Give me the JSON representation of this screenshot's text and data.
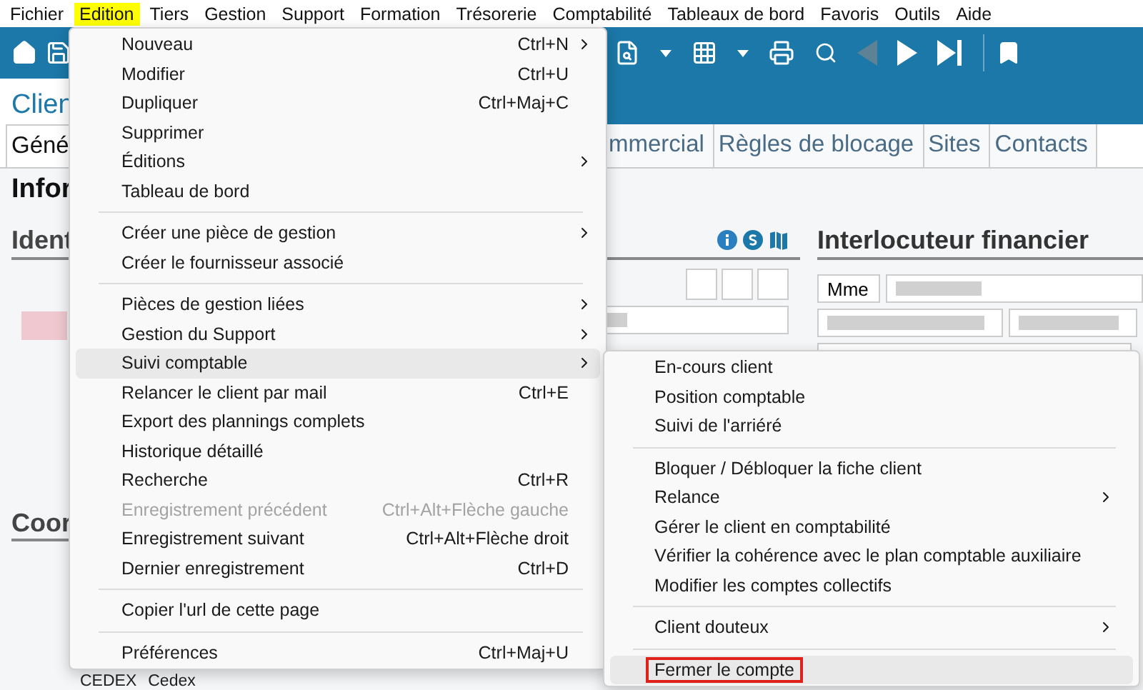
{
  "menubar": [
    {
      "label": "Fichier",
      "selected": false
    },
    {
      "label": "Edition",
      "selected": true
    },
    {
      "label": "Tiers",
      "selected": false
    },
    {
      "label": "Gestion",
      "selected": false
    },
    {
      "label": "Support",
      "selected": false
    },
    {
      "label": "Formation",
      "selected": false
    },
    {
      "label": "Trésorerie",
      "selected": false
    },
    {
      "label": "Comptabilité",
      "selected": false
    },
    {
      "label": "Tableaux de bord",
      "selected": false
    },
    {
      "label": "Favoris",
      "selected": false
    },
    {
      "label": "Outils",
      "selected": false
    },
    {
      "label": "Aide",
      "selected": false
    }
  ],
  "toolbar": {
    "left": [
      {
        "kind": "home",
        "disabled": false
      },
      {
        "kind": "save",
        "disabled": false
      }
    ],
    "right": [
      {
        "kind": "find-doc",
        "disabled": false
      },
      {
        "kind": "caret",
        "disabled": false
      },
      {
        "kind": "grid",
        "disabled": false
      },
      {
        "kind": "caret",
        "disabled": false
      },
      {
        "kind": "print",
        "disabled": false
      },
      {
        "kind": "search",
        "disabled": false
      },
      {
        "kind": "prev",
        "disabled": true
      },
      {
        "kind": "next",
        "disabled": false
      },
      {
        "kind": "last",
        "disabled": false
      },
      {
        "kind": "separator"
      },
      {
        "kind": "bookmark",
        "disabled": false
      }
    ]
  },
  "page": {
    "title": "Clien",
    "tabs": [
      {
        "label": "Géné",
        "selected": true
      },
      {
        "label": "mmercial",
        "selected": false
      },
      {
        "label": "Règles de blocage",
        "selected": false
      },
      {
        "label": "Sites",
        "selected": false
      },
      {
        "label": "Contacts",
        "selected": false
      }
    ],
    "section": "Infor",
    "identity": {
      "heading": "Ident"
    },
    "coordinates": {
      "heading": "Coor",
      "postal_code": "CEDEX",
      "city": "Cedex"
    },
    "financial": {
      "heading": "Interlocuteur financier",
      "civility": "Mme"
    }
  },
  "menu": {
    "items": [
      {
        "kind": "item",
        "label": "Nouveau",
        "shortcut": "Ctrl+N",
        "submenu": true,
        "disabled": false,
        "selected": false
      },
      {
        "kind": "item",
        "label": "Modifier",
        "shortcut": "Ctrl+U",
        "submenu": false,
        "disabled": false,
        "selected": false
      },
      {
        "kind": "item",
        "label": "Dupliquer",
        "shortcut": "Ctrl+Maj+C",
        "submenu": false,
        "disabled": false,
        "selected": false
      },
      {
        "kind": "item",
        "label": "Supprimer",
        "submenu": false,
        "disabled": false,
        "selected": false
      },
      {
        "kind": "item",
        "label": "Éditions",
        "submenu": true,
        "disabled": false,
        "selected": false
      },
      {
        "kind": "item",
        "label": "Tableau de bord",
        "submenu": false,
        "disabled": false,
        "selected": false
      },
      {
        "kind": "separator"
      },
      {
        "kind": "item",
        "label": "Créer une pièce de gestion",
        "submenu": true,
        "disabled": false,
        "selected": false
      },
      {
        "kind": "item",
        "label": "Créer le fournisseur associé",
        "submenu": false,
        "disabled": false,
        "selected": false
      },
      {
        "kind": "separator"
      },
      {
        "kind": "item",
        "label": "Pièces de gestion liées",
        "submenu": true,
        "disabled": false,
        "selected": false
      },
      {
        "kind": "item",
        "label": "Gestion du Support",
        "submenu": true,
        "disabled": false,
        "selected": false
      },
      {
        "kind": "item",
        "label": "Suivi comptable",
        "submenu": true,
        "disabled": false,
        "selected": true
      },
      {
        "kind": "item",
        "label": "Relancer le client par mail",
        "shortcut": "Ctrl+E",
        "submenu": false,
        "disabled": false,
        "selected": false
      },
      {
        "kind": "item",
        "label": "Export des plannings complets",
        "submenu": false,
        "disabled": false,
        "selected": false
      },
      {
        "kind": "item",
        "label": "Historique détaillé",
        "submenu": false,
        "disabled": false,
        "selected": false
      },
      {
        "kind": "item",
        "label": "Recherche",
        "shortcut": "Ctrl+R",
        "submenu": false,
        "disabled": false,
        "selected": false
      },
      {
        "kind": "item",
        "label": "Enregistrement précédent",
        "shortcut": "Ctrl+Alt+Flèche gauche",
        "submenu": false,
        "disabled": true,
        "selected": false
      },
      {
        "kind": "item",
        "label": "Enregistrement suivant",
        "shortcut": "Ctrl+Alt+Flèche droit",
        "submenu": false,
        "disabled": false,
        "selected": false
      },
      {
        "kind": "item",
        "label": "Dernier enregistrement",
        "shortcut": "Ctrl+D",
        "submenu": false,
        "disabled": false,
        "selected": false
      },
      {
        "kind": "separator"
      },
      {
        "kind": "item",
        "label": "Copier l'url de cette page",
        "submenu": false,
        "disabled": false,
        "selected": false
      },
      {
        "kind": "separator"
      },
      {
        "kind": "item",
        "label": "Préférences",
        "shortcut": "Ctrl+Maj+U",
        "submenu": false,
        "disabled": false,
        "selected": false
      }
    ]
  },
  "submenu": {
    "items": [
      {
        "kind": "item",
        "label": "En-cours client",
        "submenu": false,
        "selected": false,
        "outlined": false
      },
      {
        "kind": "item",
        "label": "Position comptable",
        "submenu": false,
        "selected": false,
        "outlined": false
      },
      {
        "kind": "item",
        "label": "Suivi de l'arriéré",
        "submenu": false,
        "selected": false,
        "outlined": false
      },
      {
        "kind": "separator"
      },
      {
        "kind": "item",
        "label": "Bloquer / Débloquer la fiche client",
        "submenu": false,
        "selected": false,
        "outlined": false
      },
      {
        "kind": "item",
        "label": "Relance",
        "submenu": true,
        "selected": false,
        "outlined": false
      },
      {
        "kind": "item",
        "label": "Gérer le client en comptabilité",
        "submenu": false,
        "selected": false,
        "outlined": false
      },
      {
        "kind": "item",
        "label": "Vérifier la cohérence avec le plan comptable auxiliaire",
        "submenu": false,
        "selected": false,
        "outlined": false
      },
      {
        "kind": "item",
        "label": "Modifier les comptes collectifs",
        "submenu": false,
        "selected": false,
        "outlined": false
      },
      {
        "kind": "separator"
      },
      {
        "kind": "item",
        "label": "Client douteux",
        "submenu": true,
        "selected": false,
        "outlined": false
      },
      {
        "kind": "separator"
      },
      {
        "kind": "item",
        "label": "Fermer le compte",
        "submenu": false,
        "selected": true,
        "outlined": true
      }
    ]
  }
}
